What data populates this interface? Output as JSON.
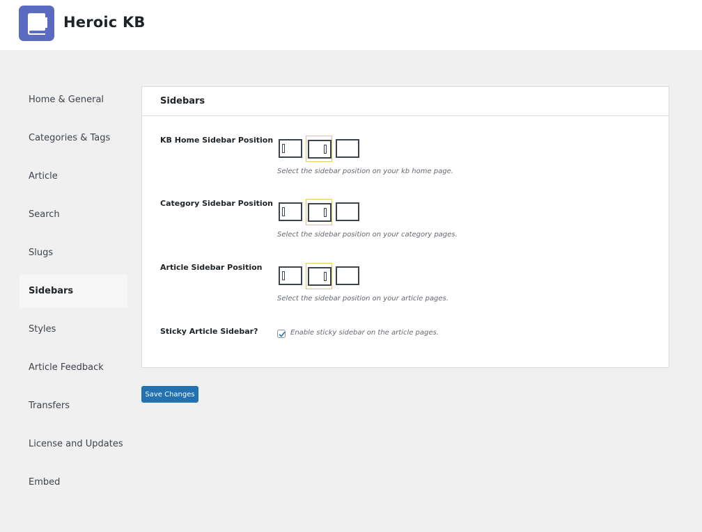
{
  "app": {
    "title": "Heroic KB",
    "logo_icon": "book-icon",
    "brand_color": "#5b6bbf"
  },
  "sidebar": {
    "items": [
      {
        "label": "Home & General"
      },
      {
        "label": "Categories & Tags"
      },
      {
        "label": "Article"
      },
      {
        "label": "Search"
      },
      {
        "label": "Slugs"
      },
      {
        "label": "Sidebars",
        "active": true
      },
      {
        "label": "Styles"
      },
      {
        "label": "Article Feedback"
      },
      {
        "label": "Transfers"
      },
      {
        "label": "License and Updates"
      },
      {
        "label": "Embed"
      }
    ]
  },
  "panel": {
    "title": "Sidebars",
    "rows": [
      {
        "label": "KB Home Sidebar Position",
        "hint": "Select the sidebar position on your kb home page.",
        "options": [
          "sidebar-left",
          "sidebar-right",
          "no-sidebar"
        ],
        "selected": "sidebar-right"
      },
      {
        "label": "Category Sidebar Position",
        "hint": "Select the sidebar position on your category pages.",
        "options": [
          "sidebar-left",
          "sidebar-right",
          "no-sidebar"
        ],
        "selected": "sidebar-right"
      },
      {
        "label": "Article Sidebar Position",
        "hint": "Select the sidebar position on your article pages.",
        "options": [
          "sidebar-left",
          "sidebar-right",
          "no-sidebar"
        ],
        "selected": "sidebar-right"
      }
    ],
    "sticky": {
      "label": "Sticky Article Sidebar?",
      "checkbox_label": "Enable sticky sidebar on the article pages.",
      "checked": true
    }
  },
  "save_button": {
    "label": "Save Changes",
    "color": "#2271b1"
  },
  "colors": {
    "selected_option_border": "#e6c75a",
    "background": "#f0f0f1"
  }
}
